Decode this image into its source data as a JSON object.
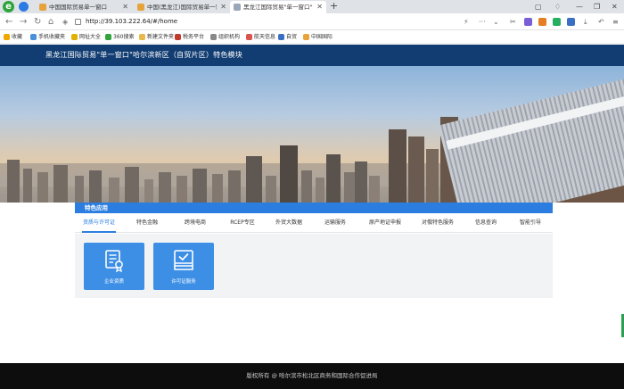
{
  "browser": {
    "logo_letter": "e",
    "tabs": [
      {
        "label": "中国国际贸易单一窗口"
      },
      {
        "label": "中国(黑龙江)国际贸易单一窗口"
      },
      {
        "label": "黑龙江国际贸易\"单一窗口\"哈尔滨"
      }
    ],
    "new_tab": "+",
    "url": "http://39.103.222.64/#/home",
    "bookmarks": [
      {
        "label": "收藏",
        "icon": "star-icon",
        "color": "#f0a800"
      },
      {
        "label": "手机收藏夹",
        "icon": "phone-icon",
        "color": "#4a90d9"
      },
      {
        "label": "网址大全",
        "icon": "globe-icon",
        "color": "#e2b000"
      },
      {
        "label": "360搜索",
        "icon": "search-icon",
        "color": "#2ea43a"
      },
      {
        "label": "新建文件夹",
        "icon": "folder-icon",
        "color": "#e8b84a"
      },
      {
        "label": "税务平台",
        "icon": "tax-icon",
        "color": "#c0392b"
      },
      {
        "label": "组织机构",
        "icon": "org-icon",
        "color": "#888888"
      },
      {
        "label": "航天信息",
        "icon": "aero-icon",
        "color": "#d9534f"
      },
      {
        "label": "自贸",
        "icon": "trade-icon",
        "color": "#3a6fc4"
      },
      {
        "label": "中国国际",
        "icon": "cn-icon",
        "color": "#e8a33b"
      }
    ]
  },
  "site": {
    "title": "黑龙江国际贸易\"单一窗口\"哈尔滨新区（自贸片区）特色模块",
    "brand_color": "#123d72",
    "accent_color": "#2b7ee0"
  },
  "features": {
    "panel_title": "特色应用",
    "tabs": [
      {
        "label": "资质与许可证",
        "active": true
      },
      {
        "label": "特色金融",
        "active": false
      },
      {
        "label": "跨境电商",
        "active": false
      },
      {
        "label": "RCEP专区",
        "active": false
      },
      {
        "label": "外贸大数据",
        "active": false
      },
      {
        "label": "运输服务",
        "active": false
      },
      {
        "label": "原产地证申报",
        "active": false
      },
      {
        "label": "对俄特色服务",
        "active": false
      },
      {
        "label": "信息查询",
        "active": false
      },
      {
        "label": "智能引导",
        "active": false
      }
    ],
    "cards": [
      {
        "label": "企业资质",
        "icon": "certificate-icon"
      },
      {
        "label": "许可证服务",
        "icon": "license-check-icon"
      }
    ]
  },
  "footer": {
    "copyright": "版权所有 @ 哈尔滨市松北区商务和国际合作促进局"
  }
}
